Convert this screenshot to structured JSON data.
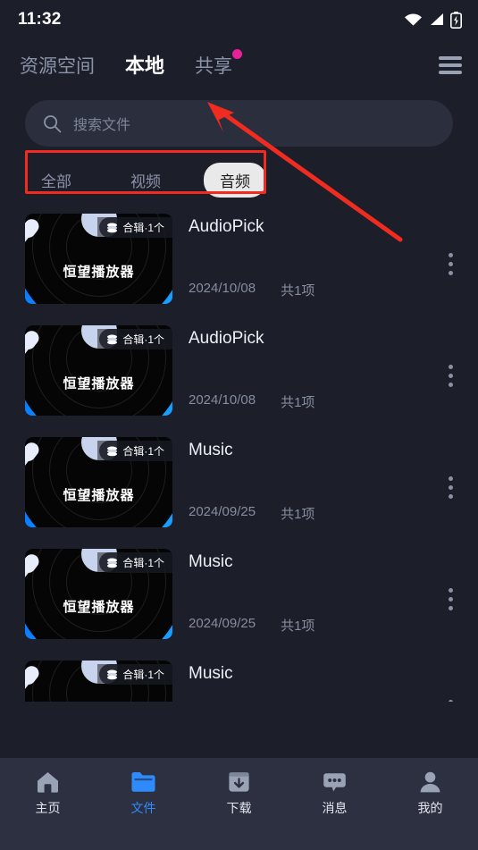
{
  "status_bar": {
    "time": "11:32",
    "icons": [
      "wifi-icon",
      "signal-icon",
      "battery-charging-icon"
    ]
  },
  "header": {
    "tabs": [
      {
        "label": "资源空间",
        "active": false,
        "badge": false
      },
      {
        "label": "本地",
        "active": true,
        "badge": false
      },
      {
        "label": "共享",
        "active": false,
        "badge": true
      }
    ],
    "menu_icon": "hamburger-icon",
    "badge_color": "#e6219b"
  },
  "search": {
    "placeholder": "搜索文件",
    "icon": "search-icon",
    "value": ""
  },
  "filters": {
    "chips": [
      {
        "label": "全部",
        "selected": false
      },
      {
        "label": "视频",
        "selected": false
      },
      {
        "label": "音频",
        "selected": true
      }
    ],
    "highlight_color": "#f02b20"
  },
  "file_list": {
    "badge_label": "合辑·1个",
    "thumb_brand": "恒望播放器",
    "items": [
      {
        "name": "AudioPick",
        "date": "2024/10/08",
        "count": "共1项"
      },
      {
        "name": "AudioPick",
        "date": "2024/10/08",
        "count": "共1项"
      },
      {
        "name": "Music",
        "date": "2024/09/25",
        "count": "共1项"
      },
      {
        "name": "Music",
        "date": "2024/09/25",
        "count": "共1项"
      },
      {
        "name": "Music",
        "date": "",
        "count": ""
      }
    ]
  },
  "bottom_nav": {
    "active_color": "#2f8bfb",
    "items": [
      {
        "label": "主页",
        "icon": "home-icon",
        "active": false
      },
      {
        "label": "文件",
        "icon": "folder-icon",
        "active": true
      },
      {
        "label": "下载",
        "icon": "download-icon",
        "active": false
      },
      {
        "label": "消息",
        "icon": "message-icon",
        "active": false
      },
      {
        "label": "我的",
        "icon": "person-icon",
        "active": false
      }
    ]
  }
}
